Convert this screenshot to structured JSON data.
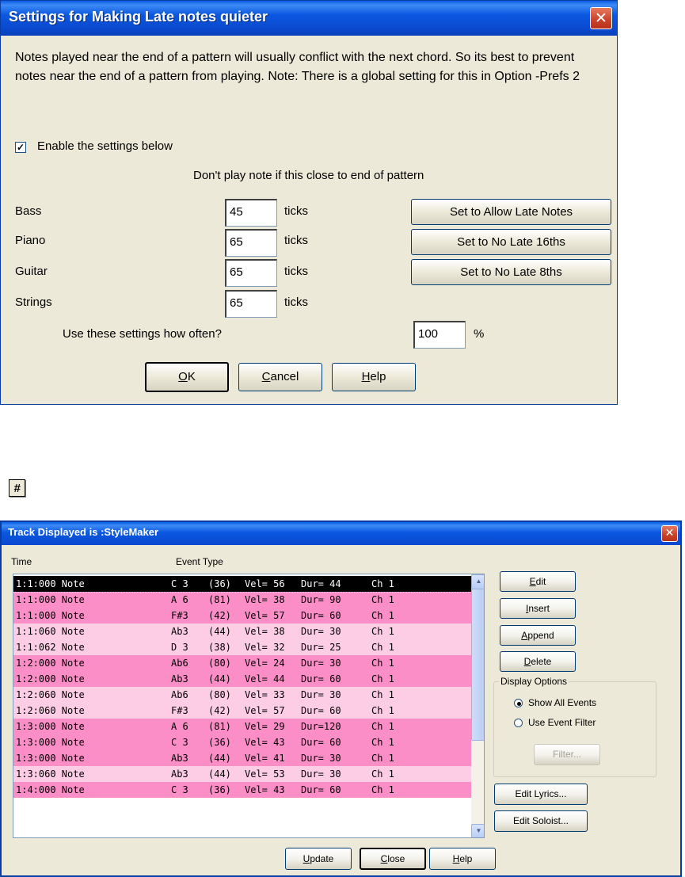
{
  "dialog1": {
    "title": "Settings for Making Late notes quieter",
    "description": "Notes played near the end of a pattern will usually conflict with the next chord. So its best to prevent notes near the end of a pattern from playing. Note: There is a global setting for this in Option -Prefs 2",
    "enable_checkbox": {
      "label": "Enable the settings below",
      "checked": true,
      "mark": "✓"
    },
    "heading": "Don't play note if this close to end of pattern",
    "instruments": [
      {
        "label": "Bass",
        "value": "45",
        "unit": "ticks"
      },
      {
        "label": "Piano",
        "value": "65",
        "unit": "ticks"
      },
      {
        "label": "Guitar",
        "value": "65",
        "unit": "ticks"
      },
      {
        "label": "Strings",
        "value": "65",
        "unit": "ticks"
      }
    ],
    "preset_buttons": [
      "Set to Allow Late Notes",
      "Set to No Late 16ths",
      "Set to No Late 8ths"
    ],
    "often": {
      "label": "Use these settings how often?",
      "value": "100",
      "unit": "%"
    },
    "buttons": {
      "ok": {
        "u": "O",
        "rest": "K"
      },
      "cancel": {
        "u": "C",
        "rest": "ancel"
      },
      "help": {
        "u": "H",
        "rest": "elp"
      }
    }
  },
  "icon_button": {
    "glyph": "#"
  },
  "dialog2": {
    "title": "Track Displayed is :StyleMaker",
    "col_time": "Time",
    "col_event": "Event Type",
    "rows": [
      {
        "time": "1:1:000 Note",
        "note": "C 3",
        "num": "(36)",
        "vel": "Vel= 56",
        "dur": "Dur= 44",
        "ch": "Ch 1",
        "style": "selected"
      },
      {
        "time": "1:1:000 Note",
        "note": "A 6",
        "num": "(81)",
        "vel": "Vel= 38",
        "dur": "Dur= 90",
        "ch": "Ch 1",
        "style": "dark"
      },
      {
        "time": "1:1:000 Note",
        "note": "F#3",
        "num": "(42)",
        "vel": "Vel= 57",
        "dur": "Dur= 60",
        "ch": "Ch 1",
        "style": "dark"
      },
      {
        "time": "1:1:060 Note",
        "note": "Ab3",
        "num": "(44)",
        "vel": "Vel= 38",
        "dur": "Dur= 30",
        "ch": "Ch 1",
        "style": "light"
      },
      {
        "time": "1:1:062 Note",
        "note": "D 3",
        "num": "(38)",
        "vel": "Vel= 32",
        "dur": "Dur= 25",
        "ch": "Ch 1",
        "style": "light"
      },
      {
        "time": "1:2:000 Note",
        "note": "Ab6",
        "num": "(80)",
        "vel": "Vel= 24",
        "dur": "Dur= 30",
        "ch": "Ch 1",
        "style": "dark"
      },
      {
        "time": "1:2:000 Note",
        "note": "Ab3",
        "num": "(44)",
        "vel": "Vel= 44",
        "dur": "Dur= 60",
        "ch": "Ch 1",
        "style": "dark"
      },
      {
        "time": "1:2:060 Note",
        "note": "Ab6",
        "num": "(80)",
        "vel": "Vel= 33",
        "dur": "Dur= 30",
        "ch": "Ch 1",
        "style": "light"
      },
      {
        "time": "1:2:060 Note",
        "note": "F#3",
        "num": "(42)",
        "vel": "Vel= 57",
        "dur": "Dur= 60",
        "ch": "Ch 1",
        "style": "light"
      },
      {
        "time": "1:3:000 Note",
        "note": "A 6",
        "num": "(81)",
        "vel": "Vel= 29",
        "dur": "Dur=120",
        "ch": "Ch 1",
        "style": "dark"
      },
      {
        "time": "1:3:000 Note",
        "note": "C 3",
        "num": "(36)",
        "vel": "Vel= 43",
        "dur": "Dur= 60",
        "ch": "Ch 1",
        "style": "dark"
      },
      {
        "time": "1:3:000 Note",
        "note": "Ab3",
        "num": "(44)",
        "vel": "Vel= 41",
        "dur": "Dur= 30",
        "ch": "Ch 1",
        "style": "dark"
      },
      {
        "time": "1:3:060 Note",
        "note": "Ab3",
        "num": "(44)",
        "vel": "Vel= 53",
        "dur": "Dur= 30",
        "ch": "Ch 1",
        "style": "light"
      },
      {
        "time": "1:4:000 Note",
        "note": "C 3",
        "num": "(36)",
        "vel": "Vel= 43",
        "dur": "Dur= 60",
        "ch": "Ch 1",
        "style": "dark"
      }
    ],
    "side_buttons": {
      "edit": {
        "u": "E",
        "rest": "dit"
      },
      "insert": {
        "u": "I",
        "rest": "nsert"
      },
      "append": {
        "u": "A",
        "rest": "ppend"
      },
      "delete": {
        "u": "D",
        "rest": "elete"
      }
    },
    "display_options": {
      "legend": "Display Options",
      "show_all": "Show All Events",
      "use_filter": "Use Event Filter",
      "filter_button": "Filter..."
    },
    "edit_lyrics": "Edit Lyrics...",
    "edit_soloist": "Edit Soloist...",
    "bottom_buttons": {
      "update": {
        "u": "U",
        "rest": "pdate"
      },
      "close": {
        "u": "C",
        "rest": "lose"
      },
      "help": {
        "u": "H",
        "rest": "elp"
      }
    }
  },
  "colors": {
    "row_dark": "#fb8ec6",
    "row_light": "#fdcde6",
    "row_selected": "#000000",
    "titlebar": "#0a4fd6"
  }
}
